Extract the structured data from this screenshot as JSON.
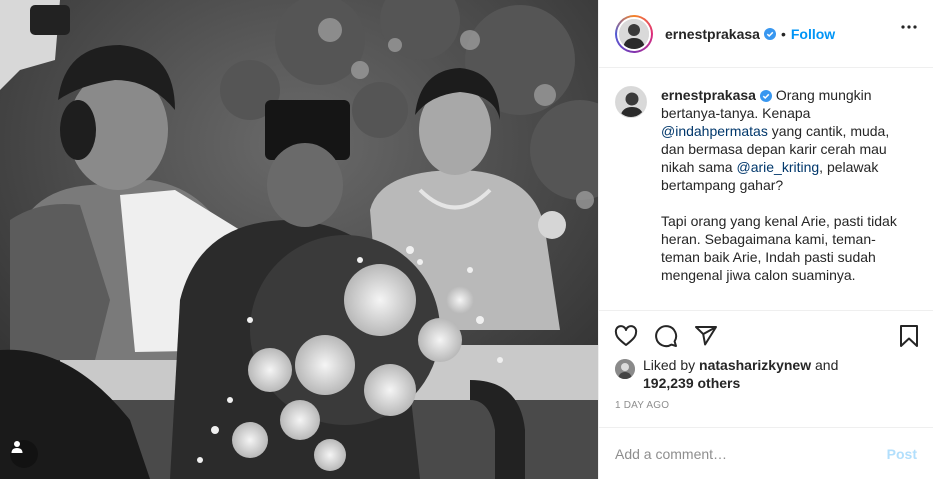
{
  "post": {
    "author": "ernestprakasa",
    "follow_label": "Follow",
    "dot": "•",
    "caption_lines": [
      [
        "text",
        " Orang mungkin bertanya-tanya. Kenapa "
      ],
      [
        "mention",
        "@indahpermatas"
      ],
      [
        "text",
        " yang cantik, muda, dan bermasa depan karir cerah mau nikah sama "
      ],
      [
        "mention",
        "@arie_kriting"
      ],
      [
        "text",
        ", pelawak bertampang gahar?"
      ]
    ],
    "caption_p1_pre": "Orang mungkin bertanya-tanya. Kenapa",
    "caption_m1": "@indahpermatas",
    "caption_p1_mid": "yang cantik, muda, dan bermasa depan karir cerah mau nikah sama",
    "caption_m2": "@arie_kriting",
    "caption_p1_post": ", pelawak bertampang gahar?",
    "caption_p2": "Tapi orang yang kenal Arie, pasti tidak heran. Sebagaimana kami, teman-teman baik Arie, Indah pasti sudah mengenal jiwa calon suaminya.",
    "likes_prefix": "Liked by",
    "liker": "natasharizkynew",
    "likes_mid": "and",
    "likes_count": "192,239 others",
    "time": "1 DAY AGO"
  },
  "comment_box": {
    "placeholder": "Add a comment…",
    "post_label": "Post"
  },
  "colors": {
    "accent": "#0095f6",
    "mention": "#00376b",
    "muted": "#8e8e8e",
    "post_disabled": "#b2dffc"
  },
  "icons": [
    "verified-badge-icon",
    "more-options-icon",
    "heart-icon",
    "comment-icon",
    "share-icon",
    "bookmark-icon",
    "user-tag-icon"
  ]
}
